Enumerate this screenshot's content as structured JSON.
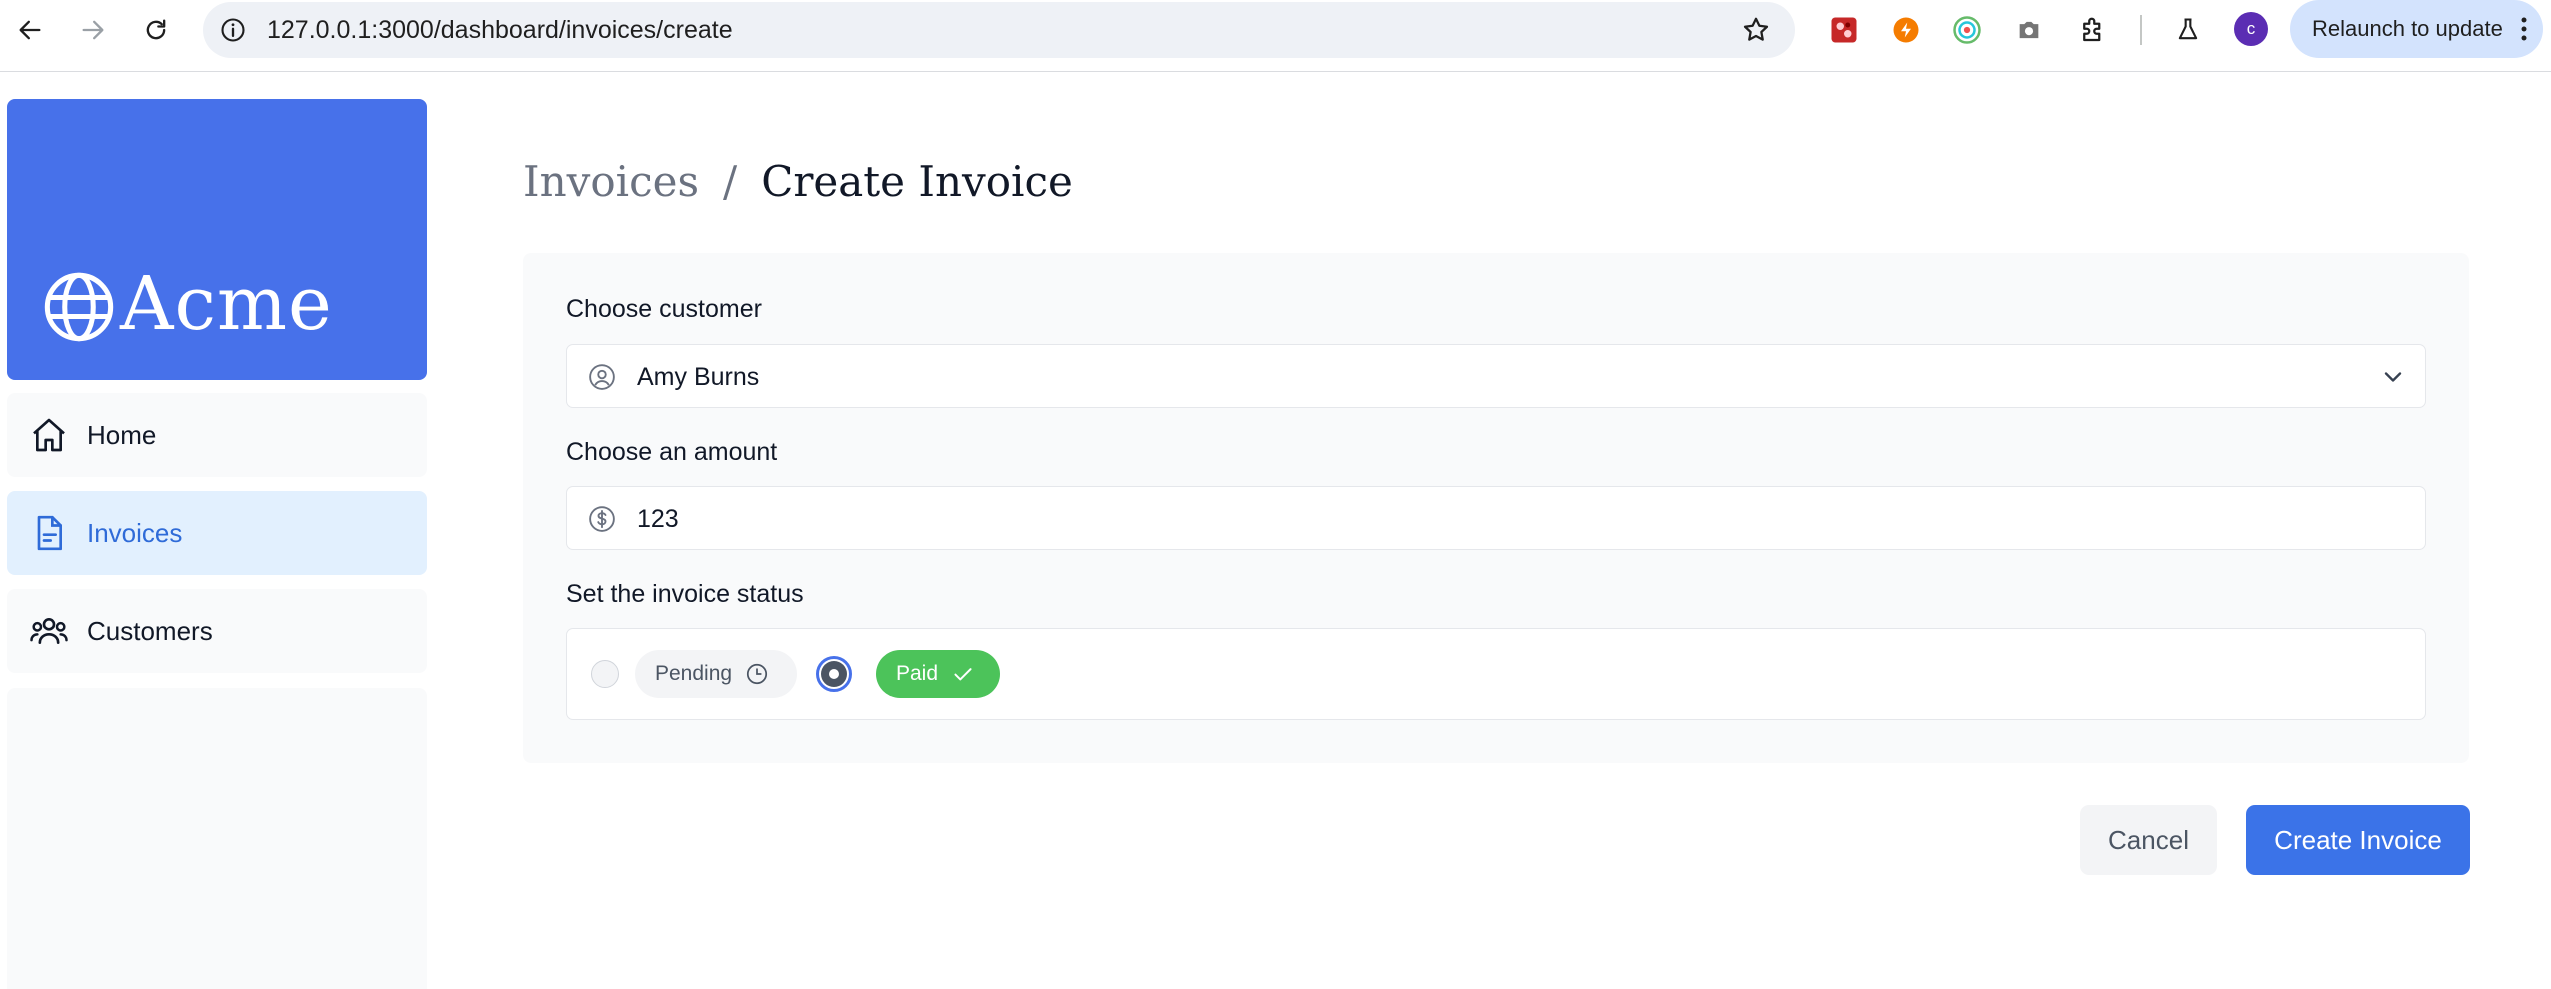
{
  "browser": {
    "url": "127.0.0.1:3000/dashboard/invoices/create",
    "profile_initial": "c",
    "relaunch_label": "Relaunch to update",
    "icons": [
      "back-arrow-icon",
      "forward-arrow-icon",
      "reload-icon",
      "site-info-icon",
      "bookmark-star-icon",
      "extension-red-icon",
      "extension-orange-icon",
      "extension-green-icon",
      "camera-icon",
      "puzzle-extensions-icon",
      "labs-flask-icon",
      "more-vert-icon"
    ]
  },
  "sidebar": {
    "logo_text": "Acme",
    "items": [
      {
        "label": "Home",
        "icon": "home-icon",
        "active": false
      },
      {
        "label": "Invoices",
        "icon": "document-icon",
        "active": true
      },
      {
        "label": "Customers",
        "icon": "users-icon",
        "active": false
      }
    ]
  },
  "breadcrumb": {
    "parent": "Invoices",
    "separator": "/",
    "current": "Create Invoice"
  },
  "form": {
    "customer": {
      "label": "Choose customer",
      "value": "Amy Burns",
      "icon": "user-circle-icon"
    },
    "amount": {
      "label": "Choose an amount",
      "value": "123",
      "icon": "dollar-circle-icon"
    },
    "status": {
      "label": "Set the invoice status",
      "options": [
        {
          "label": "Pending",
          "icon": "clock-icon",
          "selected": false
        },
        {
          "label": "Paid",
          "icon": "check-icon",
          "selected": true
        }
      ]
    }
  },
  "actions": {
    "cancel_label": "Cancel",
    "submit_label": "Create Invoice"
  },
  "colors": {
    "brand_blue": "#4771ea",
    "active_nav_bg": "#e2f0fe",
    "paid_green": "#4cc35a",
    "primary_button": "#3b73e8"
  }
}
